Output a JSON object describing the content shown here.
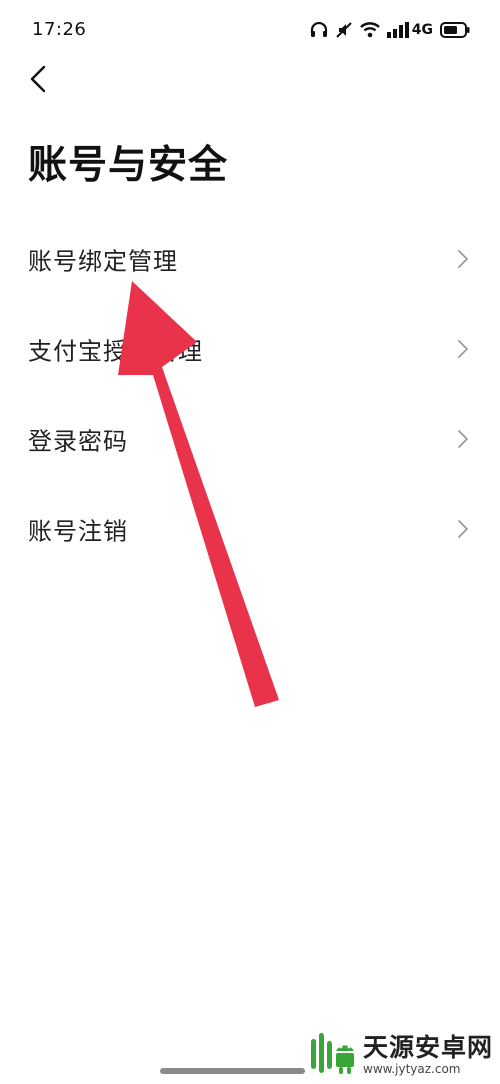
{
  "status_bar": {
    "time": "17:26",
    "icons": [
      "headphones-icon",
      "mute-icon",
      "wifi-icon",
      "signal-icon",
      "battery-icon"
    ],
    "network": "4G"
  },
  "nav": {
    "back_icon": "chevron-left-icon"
  },
  "page": {
    "title": "账号与安全"
  },
  "menu": {
    "items": [
      {
        "label": "账号绑定管理"
      },
      {
        "label": "支付宝授权管理"
      },
      {
        "label": "登录密码"
      },
      {
        "label": "账号注销"
      }
    ]
  },
  "overlay": {
    "arrow_color": "#e8334a"
  },
  "watermark": {
    "title": "天源安卓网",
    "url": "www.jytyaz.com",
    "brand_color": "#3aa63a"
  }
}
